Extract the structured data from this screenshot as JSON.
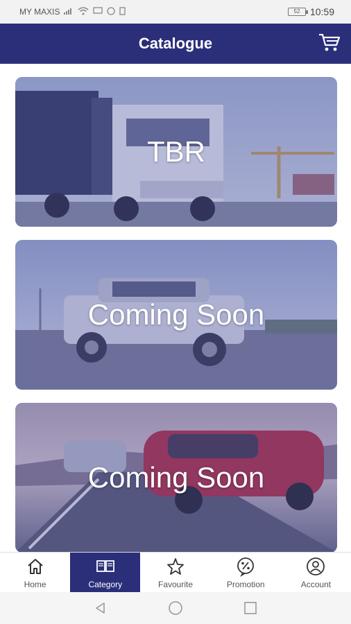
{
  "status_bar": {
    "carrier": "MY MAXIS",
    "battery": "52",
    "time": "10:59"
  },
  "header": {
    "title": "Catalogue",
    "cart_icon": "shopping-cart-icon"
  },
  "cards": [
    {
      "label": "TBR",
      "image": "truck-image"
    },
    {
      "label": "Coming Soon",
      "image": "pickup-truck-image"
    },
    {
      "label": "Coming Soon",
      "image": "cars-on-road-image"
    }
  ],
  "bottom_nav": {
    "active": "Category",
    "items": [
      {
        "label": "Home",
        "icon": "home-icon"
      },
      {
        "label": "Category",
        "icon": "book-icon"
      },
      {
        "label": "Favourite",
        "icon": "star-icon"
      },
      {
        "label": "Promotion",
        "icon": "percent-badge-icon"
      },
      {
        "label": "Account",
        "icon": "user-circle-icon"
      }
    ]
  },
  "colors": {
    "primary": "#2b2f7a",
    "overlay": "#3c4096"
  }
}
